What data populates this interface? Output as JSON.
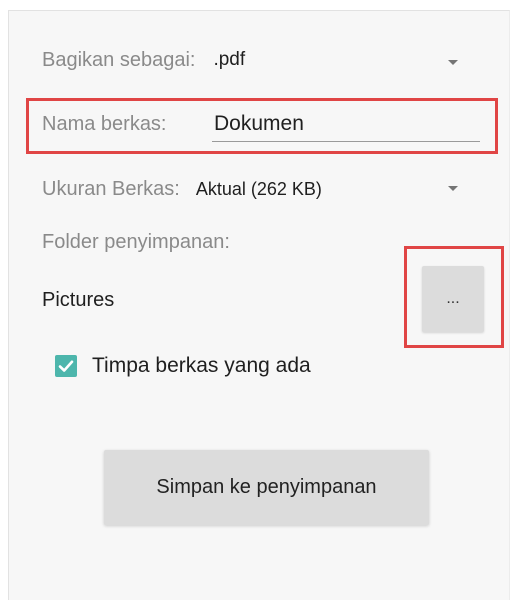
{
  "share_as": {
    "label": "Bagikan sebagai:",
    "value": ".pdf"
  },
  "file_name": {
    "label": "Nama berkas:",
    "value": "Dokumen"
  },
  "file_size": {
    "label": "Ukuran Berkas:",
    "value": "Aktual (262 KB)"
  },
  "storage_folder": {
    "label": "Folder penyimpanan:",
    "path": "Pictures",
    "browse_label": "..."
  },
  "overwrite": {
    "label": "Timpa berkas yang ada",
    "checked": true
  },
  "save_button": {
    "label": "Simpan ke penyimpanan"
  },
  "colors": {
    "highlight": "#e04545",
    "checkbox": "#4db6ac",
    "button": "#dcdcdc"
  }
}
